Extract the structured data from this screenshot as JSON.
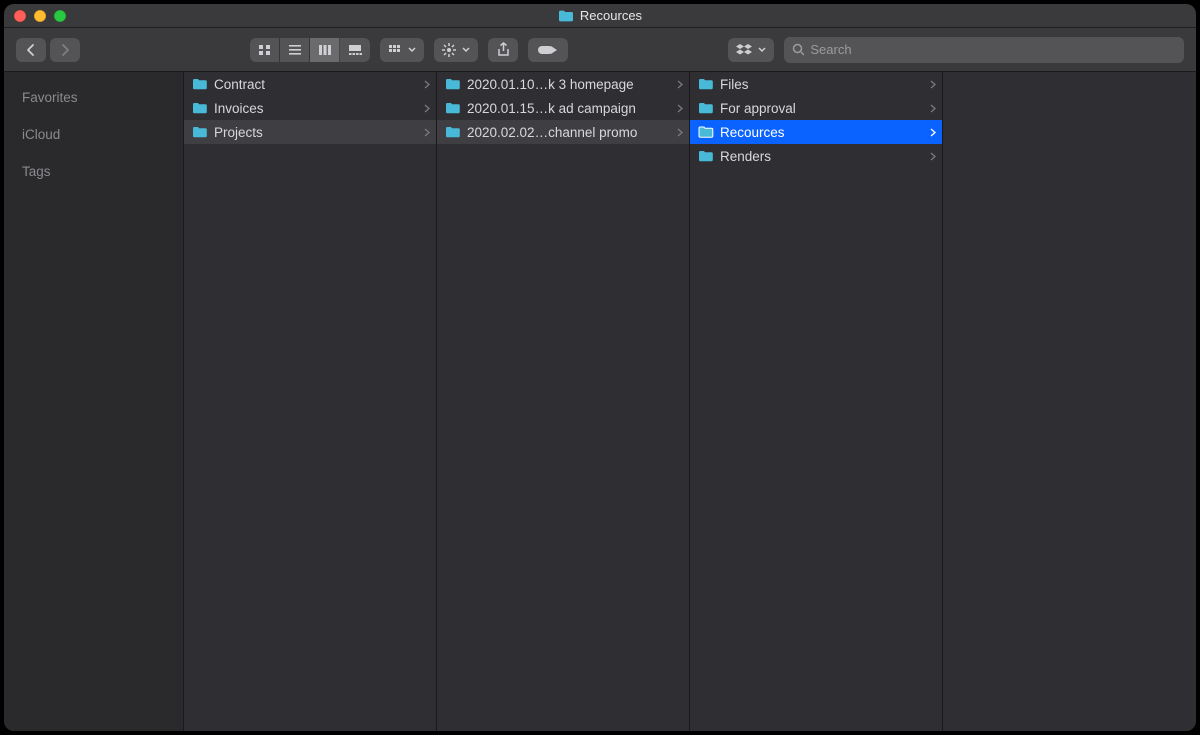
{
  "window": {
    "title": "Recources"
  },
  "toolbar": {
    "search_placeholder": "Search"
  },
  "sidebar": {
    "sections": [
      "Favorites",
      "iCloud",
      "Tags"
    ]
  },
  "columns": [
    {
      "items": [
        {
          "label": "Contract",
          "state": "normal"
        },
        {
          "label": "Invoices",
          "state": "normal"
        },
        {
          "label": "Projects",
          "state": "path"
        }
      ]
    },
    {
      "items": [
        {
          "label": "2020.01.10…k  3 homepage",
          "state": "normal"
        },
        {
          "label": "2020.01.15…k ad campaign",
          "state": "normal"
        },
        {
          "label": "2020.02.02…channel promo",
          "state": "path"
        }
      ]
    },
    {
      "items": [
        {
          "label": "Files",
          "state": "normal"
        },
        {
          "label": "For approval",
          "state": "normal"
        },
        {
          "label": "Recources",
          "state": "selected"
        },
        {
          "label": "Renders",
          "state": "normal"
        }
      ]
    },
    {
      "items": []
    }
  ],
  "colors": {
    "accent": "#0a63ff",
    "folder": "#49b9d8"
  }
}
